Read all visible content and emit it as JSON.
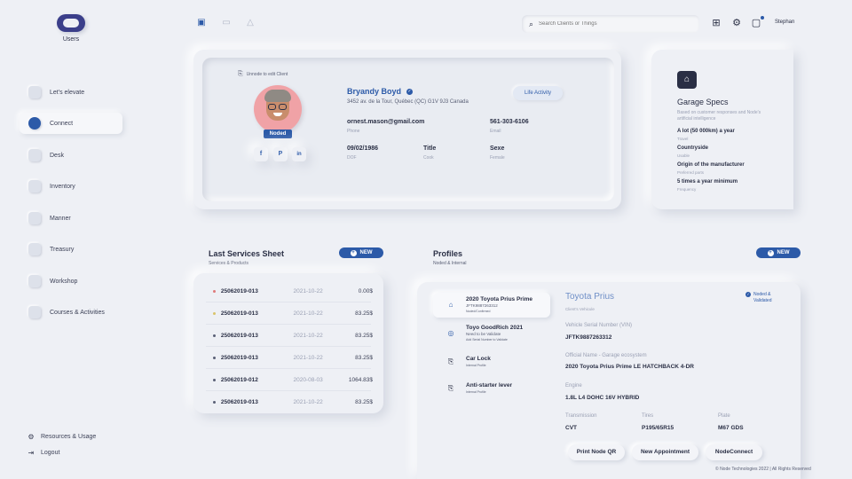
{
  "sidebar": {
    "logo_label": "Users",
    "items": [
      {
        "label": "Let's elevate"
      },
      {
        "label": "Connect"
      },
      {
        "label": "Desk"
      },
      {
        "label": "Inventory"
      },
      {
        "label": "Manner"
      },
      {
        "label": "Treasury"
      },
      {
        "label": "Workshop"
      },
      {
        "label": "Courses & Activities"
      }
    ],
    "footer": {
      "resources": "Resources & Usage",
      "logout": "Logout"
    }
  },
  "topbar": {
    "search_placeholder": "Search Clients or Things",
    "user_name": "Stephan"
  },
  "client": {
    "edit_note": "Unnode to edit Client",
    "name": "Bryandy Boyd",
    "address": "3452 av. de la Tour, Québec (QC) G1V 9J3 Canada",
    "badge": "Noded",
    "life_activity": "Life Activity",
    "social": [
      "f",
      "P",
      "in"
    ],
    "fields": [
      {
        "value": "ornest.mason@gmail.com",
        "label": "Phone"
      },
      {
        "value": "561-303-6106",
        "label": "Email"
      },
      {
        "value": "09/02/1986",
        "label": "DOF"
      },
      {
        "value": "Title",
        "label": "Cook"
      },
      {
        "value": "Sexe",
        "label": "Female"
      }
    ]
  },
  "garage": {
    "title": "Garage Specs",
    "description": "Based on customer responses and Node's artificial intelligence",
    "specs": [
      {
        "value": "A lot (50 000km) a year",
        "label": "Travel"
      },
      {
        "value": "Countryside",
        "label": "Usable"
      },
      {
        "value": "Origin of the manufacturer",
        "label": "Preferred parts"
      },
      {
        "value": "5 times a year minimum",
        "label": "Frequency"
      }
    ]
  },
  "services": {
    "title": "Last Services Sheet",
    "subtitle": "Services & Products",
    "new_label": "NEW",
    "status_colors": [
      "#e07a7a",
      "#d9c36a",
      "#5a6076",
      "#5a6076",
      "#5a6076",
      "#5a6076"
    ],
    "rows": [
      {
        "id": "25062019-013",
        "date": "2021-10-22",
        "amount": "0.00$"
      },
      {
        "id": "25062019-013",
        "date": "2021-10-22",
        "amount": "83.25$"
      },
      {
        "id": "25062019-013",
        "date": "2021-10-22",
        "amount": "83.25$"
      },
      {
        "id": "25062019-013",
        "date": "2021-10-22",
        "amount": "83.25$"
      },
      {
        "id": "25062019-012",
        "date": "2020-08-03",
        "amount": "1064.83$"
      },
      {
        "id": "25062019-013",
        "date": "2021-10-22",
        "amount": "83.25$"
      }
    ]
  },
  "profiles": {
    "title": "Profiles",
    "subtitle": "Noded & Internal",
    "new_label": "NEW",
    "items": [
      {
        "title": "2020 Toyota Prius Prime",
        "sub1": "JFTK9887263312",
        "sub2": "Noded/Confirmed"
      },
      {
        "title": "Toyo GoodRich 2021",
        "sub1": "Need to be Validate",
        "sub2": "Add Serial Number to Validate"
      },
      {
        "title": "Car Lock",
        "sub1": "Internal Profile",
        "sub2": ""
      },
      {
        "title": "Anti-starter lever",
        "sub1": "Internal Profile",
        "sub2": ""
      }
    ],
    "detail": {
      "title": "Toyota Prius",
      "subtitle": "Client's Vehicule",
      "badge": [
        "Noded &",
        "Validated"
      ],
      "vin_label": "Vehicle Serial Number (VIN)",
      "vin": "JFTK9887263312",
      "official_label": "Official Name - Garage ecosystem",
      "official": "2020 Toyota Prius Prime LE HATCHBACK 4-DR",
      "engine_label": "Engine",
      "engine": "1.8L L4 DOHC 16V HYBRID",
      "transmission_label": "Transmission",
      "transmission": "CVT",
      "tires_label": "Tires",
      "tires": "P195/65R15",
      "plate_label": "Plate",
      "plate": "M67 GDS"
    },
    "actions": [
      "Print Node QR",
      "New Appointment",
      "NodeConnect"
    ]
  },
  "copyright": "© Node Technologies 2022 | All Rights Reserved",
  "colors": {
    "accent": "#2c5aa8",
    "background": "#eef0f5",
    "avatar_bg": "#f0a2a6"
  },
  "icons": [
    "logo-toggle-icon",
    "note-icon",
    "card-icon",
    "cloud-icon",
    "search-icon",
    "grid-icon",
    "gear-icon",
    "notification-icon",
    "shield-icon",
    "car-icon",
    "tire-icon",
    "lock-icon",
    "lever-icon",
    "resources-icon",
    "logout-icon"
  ]
}
